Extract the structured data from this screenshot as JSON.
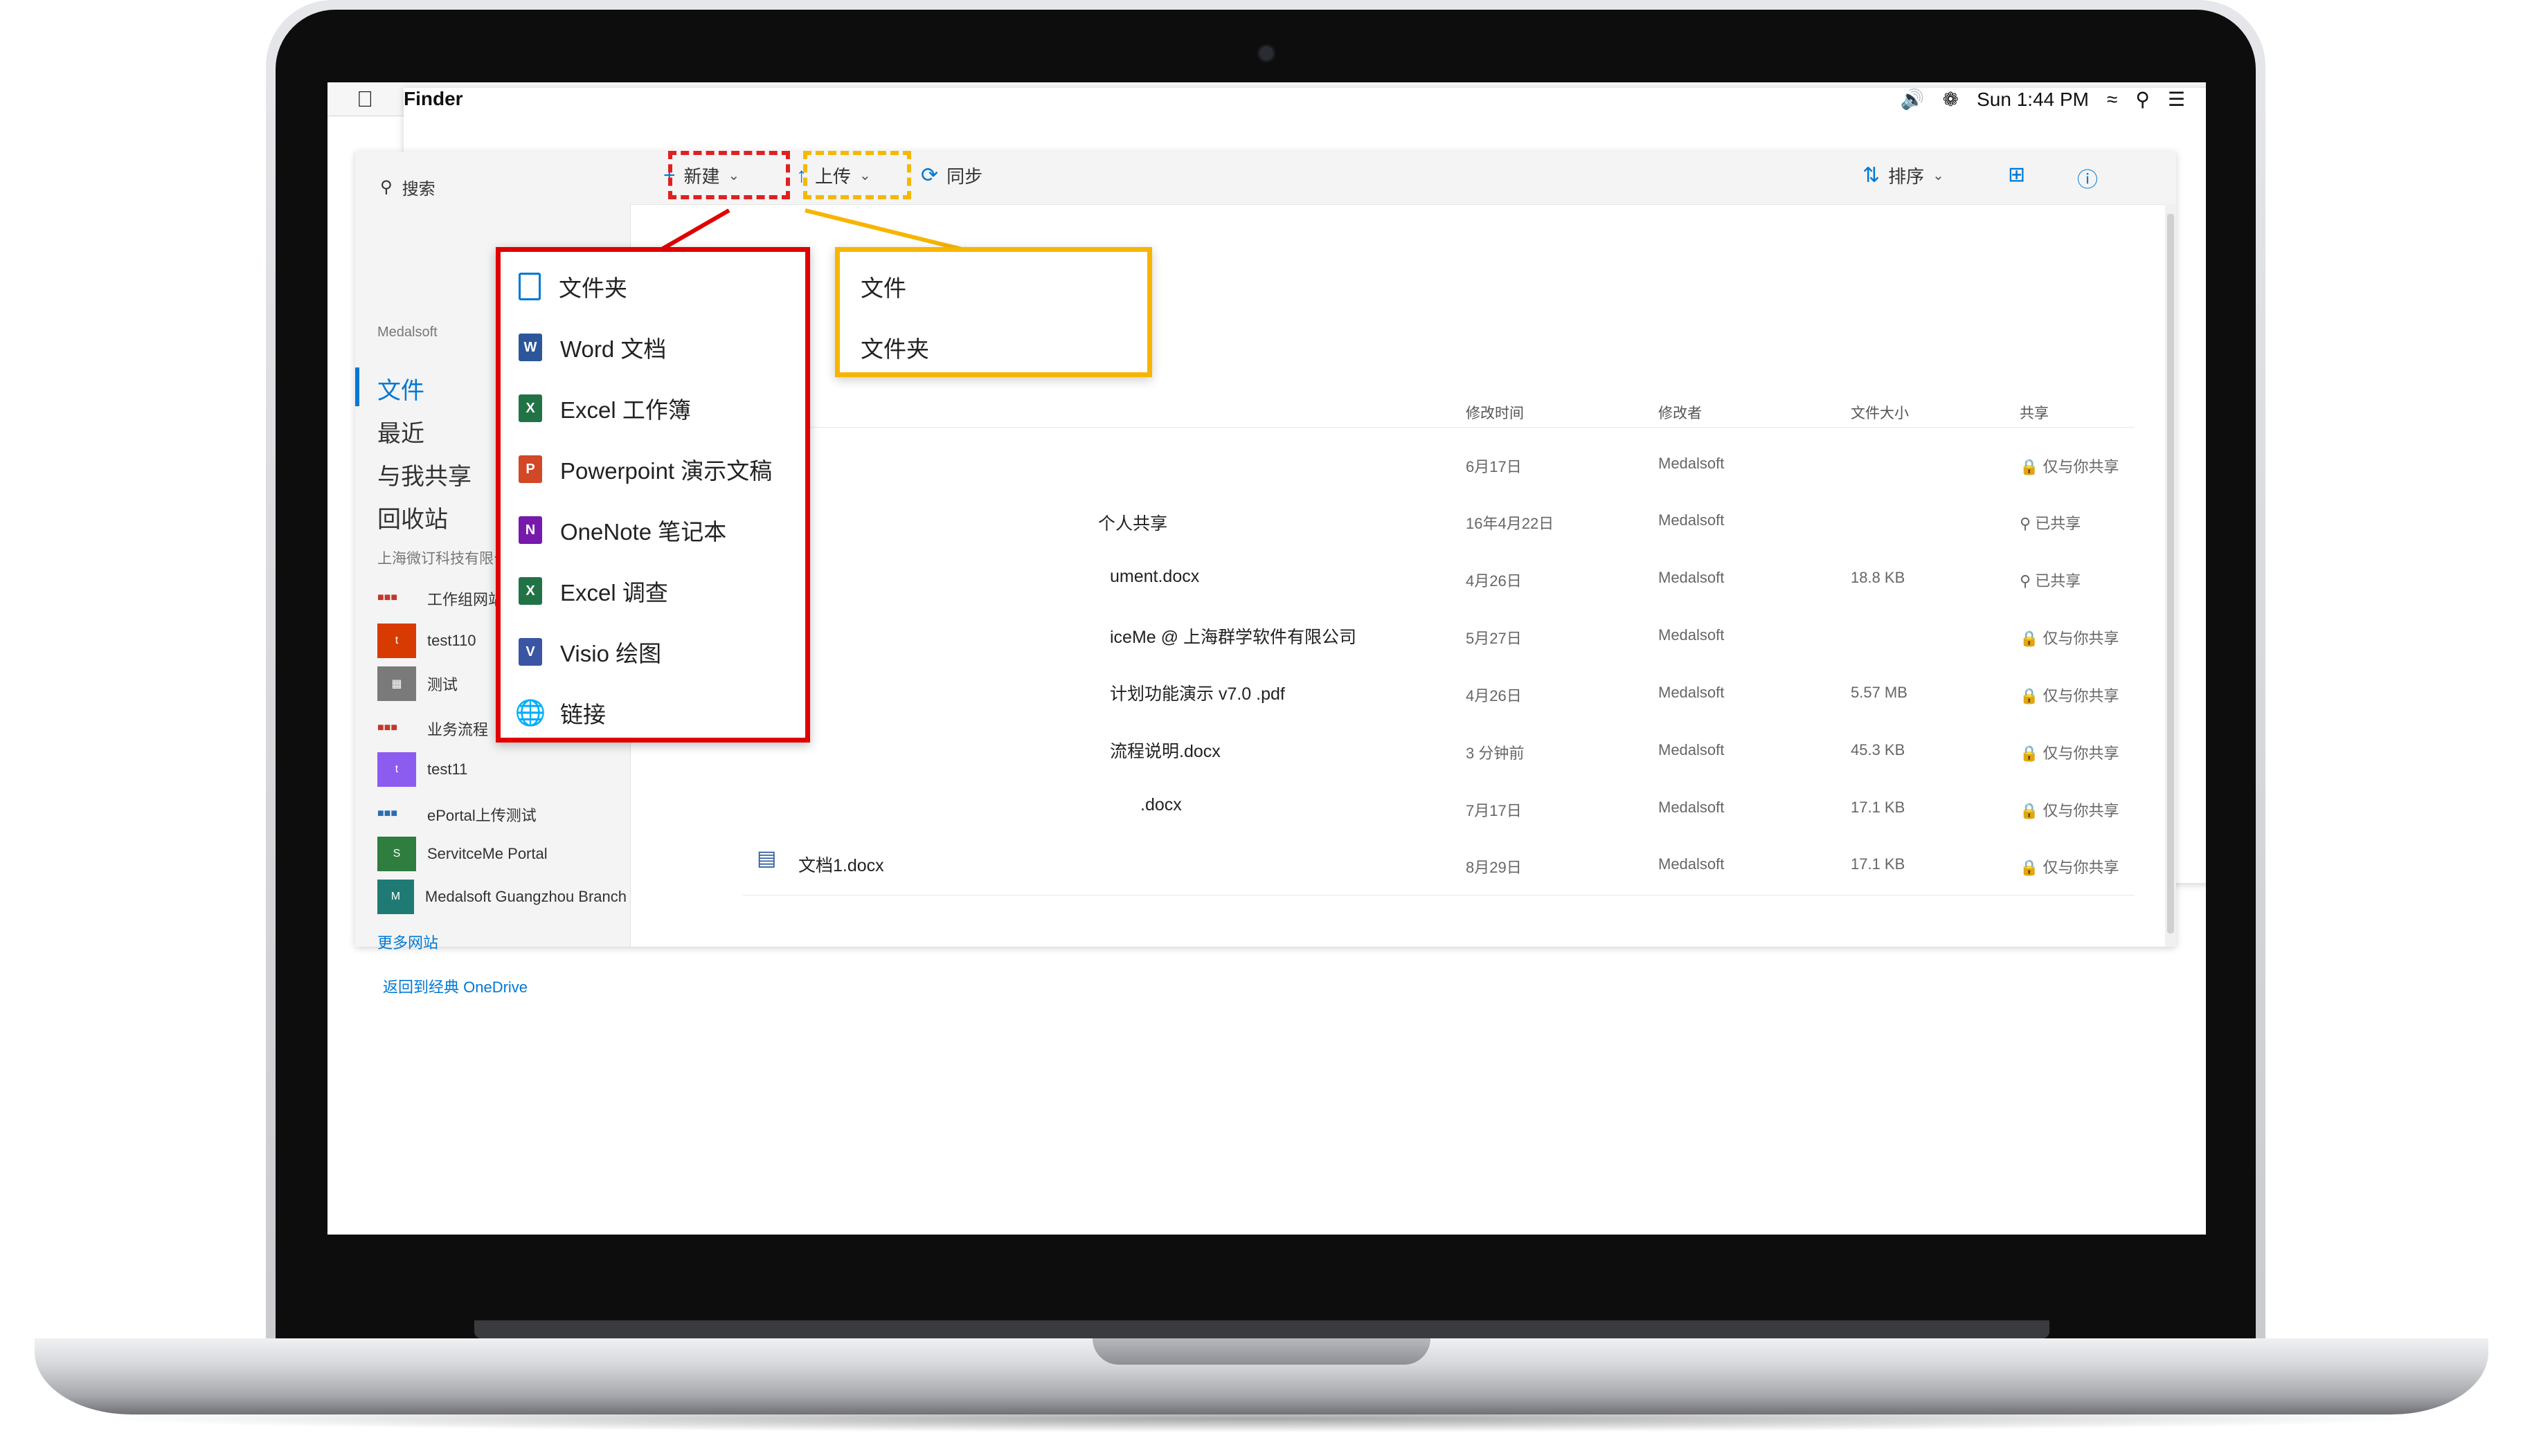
{
  "menubar": {
    "app_name": "Finder",
    "clock": "Sun 1:44 PM",
    "icons": [
      "apple-icon",
      "volume-icon",
      "bluetooth-icon",
      "wifi-icon",
      "search-icon",
      "list-icon"
    ]
  },
  "leftnav": {
    "search_label": "搜索",
    "tenant": "Medalsoft",
    "items": [
      {
        "label": "文件"
      },
      {
        "label": "最近"
      },
      {
        "label": "与我共享"
      },
      {
        "label": "回收站"
      }
    ],
    "sites_section": "上海微订科技有限公司",
    "sites": [
      {
        "label": "工作组网站",
        "tile_text": "",
        "color": "#c0392b"
      },
      {
        "label": "test110",
        "tile_text": "t",
        "color": "#d83b01"
      },
      {
        "label": "测试",
        "tile_text": "",
        "color": "#7a7a7a"
      },
      {
        "label": "业务流程",
        "tile_text": "",
        "color": "#c0392b"
      },
      {
        "label": "test11",
        "tile_text": "t",
        "color": "#8c5cf0"
      },
      {
        "label": "ePortal上传测试",
        "tile_text": "",
        "color": "#2b6cb0"
      },
      {
        "label": "ServitceMe Portal",
        "tile_text": "S",
        "color": "#2f7d3f"
      },
      {
        "label": "Medalsoft Guangzhou Branch",
        "tile_text": "M",
        "color": "#1f7a74"
      }
    ],
    "more_sites": "更多网站",
    "back_classic": "返回到经典 OneDrive"
  },
  "toolbar": {
    "new_label": "新建",
    "upload_label": "上传",
    "sync_label": "同步",
    "sort_label": "排序"
  },
  "new_menu": {
    "items": [
      {
        "label": "文件夹",
        "icon": "folder-icon",
        "color": "#0078d4"
      },
      {
        "label": "Word 文档",
        "icon": "word-icon",
        "color": "#2b579a"
      },
      {
        "label": "Excel 工作簿",
        "icon": "excel-icon",
        "color": "#217346"
      },
      {
        "label": "Powerpoint 演示文稿",
        "icon": "powerpoint-icon",
        "color": "#d24726"
      },
      {
        "label": "OneNote 笔记本",
        "icon": "onenote-icon",
        "color": "#7719aa"
      },
      {
        "label": "Excel 调查",
        "icon": "excel-survey-icon",
        "color": "#217346"
      },
      {
        "label": "Visio 绘图",
        "icon": "visio-icon",
        "color": "#3955a3"
      },
      {
        "label": "链接",
        "icon": "globe-icon",
        "color": "#0078d4"
      }
    ]
  },
  "upload_menu": {
    "items": [
      {
        "label": "文件"
      },
      {
        "label": "文件夹"
      }
    ]
  },
  "table": {
    "headers": {
      "modified": "修改时间",
      "modified_by": "修改者",
      "size": "文件大小",
      "sharing": "共享"
    },
    "rows": [
      {
        "name": "",
        "modified": "6月17日",
        "by": "Medalsoft",
        "size": "",
        "sharing": "仅与你共享"
      },
      {
        "name": "个人共享",
        "modified": "16年4月22日",
        "by": "Medalsoft",
        "size": "",
        "sharing": "已共享"
      },
      {
        "name": "ument.docx",
        "modified": "4月26日",
        "by": "Medalsoft",
        "size": "18.8 KB",
        "sharing": "已共享"
      },
      {
        "name": "iceMe @ 上海群学软件有限公司",
        "modified": "5月27日",
        "by": "Medalsoft",
        "size": "",
        "sharing": "仅与你共享"
      },
      {
        "name": "计划功能演示 v7.0 .pdf",
        "modified": "4月26日",
        "by": "Medalsoft",
        "size": "5.57 MB",
        "sharing": "仅与你共享"
      },
      {
        "name": "流程说明.docx",
        "modified": "3 分钟前",
        "by": "Medalsoft",
        "size": "45.3 KB",
        "sharing": "仅与你共享"
      },
      {
        "name": ".docx",
        "modified": "7月17日",
        "by": "Medalsoft",
        "size": "17.1 KB",
        "sharing": "仅与你共享"
      },
      {
        "name": "文档1.docx",
        "modified": "8月29日",
        "by": "Medalsoft",
        "size": "17.1 KB",
        "sharing": "仅与你共享"
      }
    ]
  },
  "colors": {
    "annotation_red": "#e00000",
    "annotation_yellow": "#f7b500",
    "accent": "#0078d4"
  }
}
